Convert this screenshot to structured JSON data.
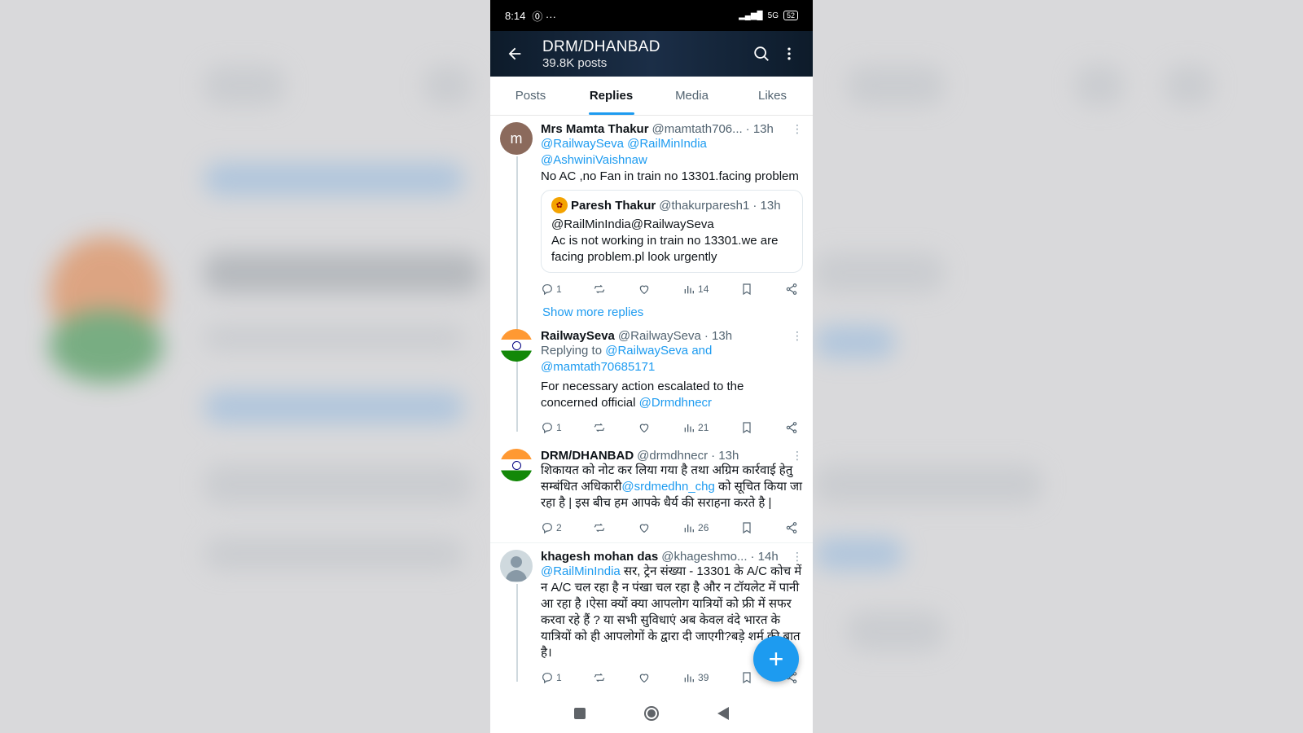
{
  "status_bar": {
    "time": "8:14",
    "extra": "⓪ ···",
    "network": "5G",
    "battery": "52"
  },
  "header": {
    "title": "DRM/DHANBAD",
    "subtitle": "39.8K posts"
  },
  "tabs": [
    {
      "label": "Posts",
      "active": false
    },
    {
      "label": "Replies",
      "active": true
    },
    {
      "label": "Media",
      "active": false
    },
    {
      "label": "Likes",
      "active": false
    }
  ],
  "tweets": [
    {
      "avatar_letter": "m",
      "name": "Mrs Mamta Thakur",
      "handle": "@mamtath706...",
      "time": "· 13h",
      "mentions": "@RailwaySeva @RailMinIndia @AshwiniVaishnaw",
      "text": "No AC ,no Fan in train no 13301.facing problem",
      "quote": {
        "name": "Paresh Thakur",
        "handle": "@thakurparesh1",
        "time": "· 13h",
        "line1": "@RailMinIndia@RailwaySeva",
        "line2": "Ac is not working in train no 13301.we are facing problem.pl look urgently"
      },
      "replies": "1",
      "retweets": "",
      "likes": "",
      "views": "14"
    },
    {
      "name": "RailwaySeva",
      "handle": "@RailwaySeva",
      "time": "· 13h",
      "replying_prefix": "Replying to",
      "replying_to": "@RailwaySeva and @mamtath70685171",
      "text": "For necessary action escalated to the concerned official",
      "text_link": "@Drmdhnecr",
      "replies": "1",
      "views": "21"
    },
    {
      "name": "DRM/DHANBAD",
      "handle": "@drmdhnecr",
      "time": "· 13h",
      "text_a": "शिकायत को नोट कर लिया गया है तथा अग्रिम कार्रवाई हेतु सम्बंधित अधिकारी",
      "text_link": "@srdmedhn_chg",
      "text_b": " को सूचित किया जा रहा है | इस बीच हम आपके धैर्य की सराहना करते है |",
      "replies": "2",
      "views": "26"
    },
    {
      "name": "khagesh mohan das",
      "handle": "@khageshmo...",
      "time": "· 14h",
      "text_link": "@RailMinIndia",
      "text": " सर, ट्रेन संख्या - 13301 के A/C कोच में न A/C चल रहा है न पंखा चल रहा है और न टॉयलेट में पानी आ रहा है ।ऐसा क्यों क्या आपलोग यात्रियों को फ्री में सफर करवा रहे हैं ? या सभी सुविधाएं अब केवल वंदे भारत के यात्रियों को ही आपलोगों के द्वारा दी जाएगी?बड़े शर्म की बात है।",
      "replies": "1",
      "views": "39"
    }
  ],
  "show_more": "Show more replies",
  "fab_label": "+"
}
